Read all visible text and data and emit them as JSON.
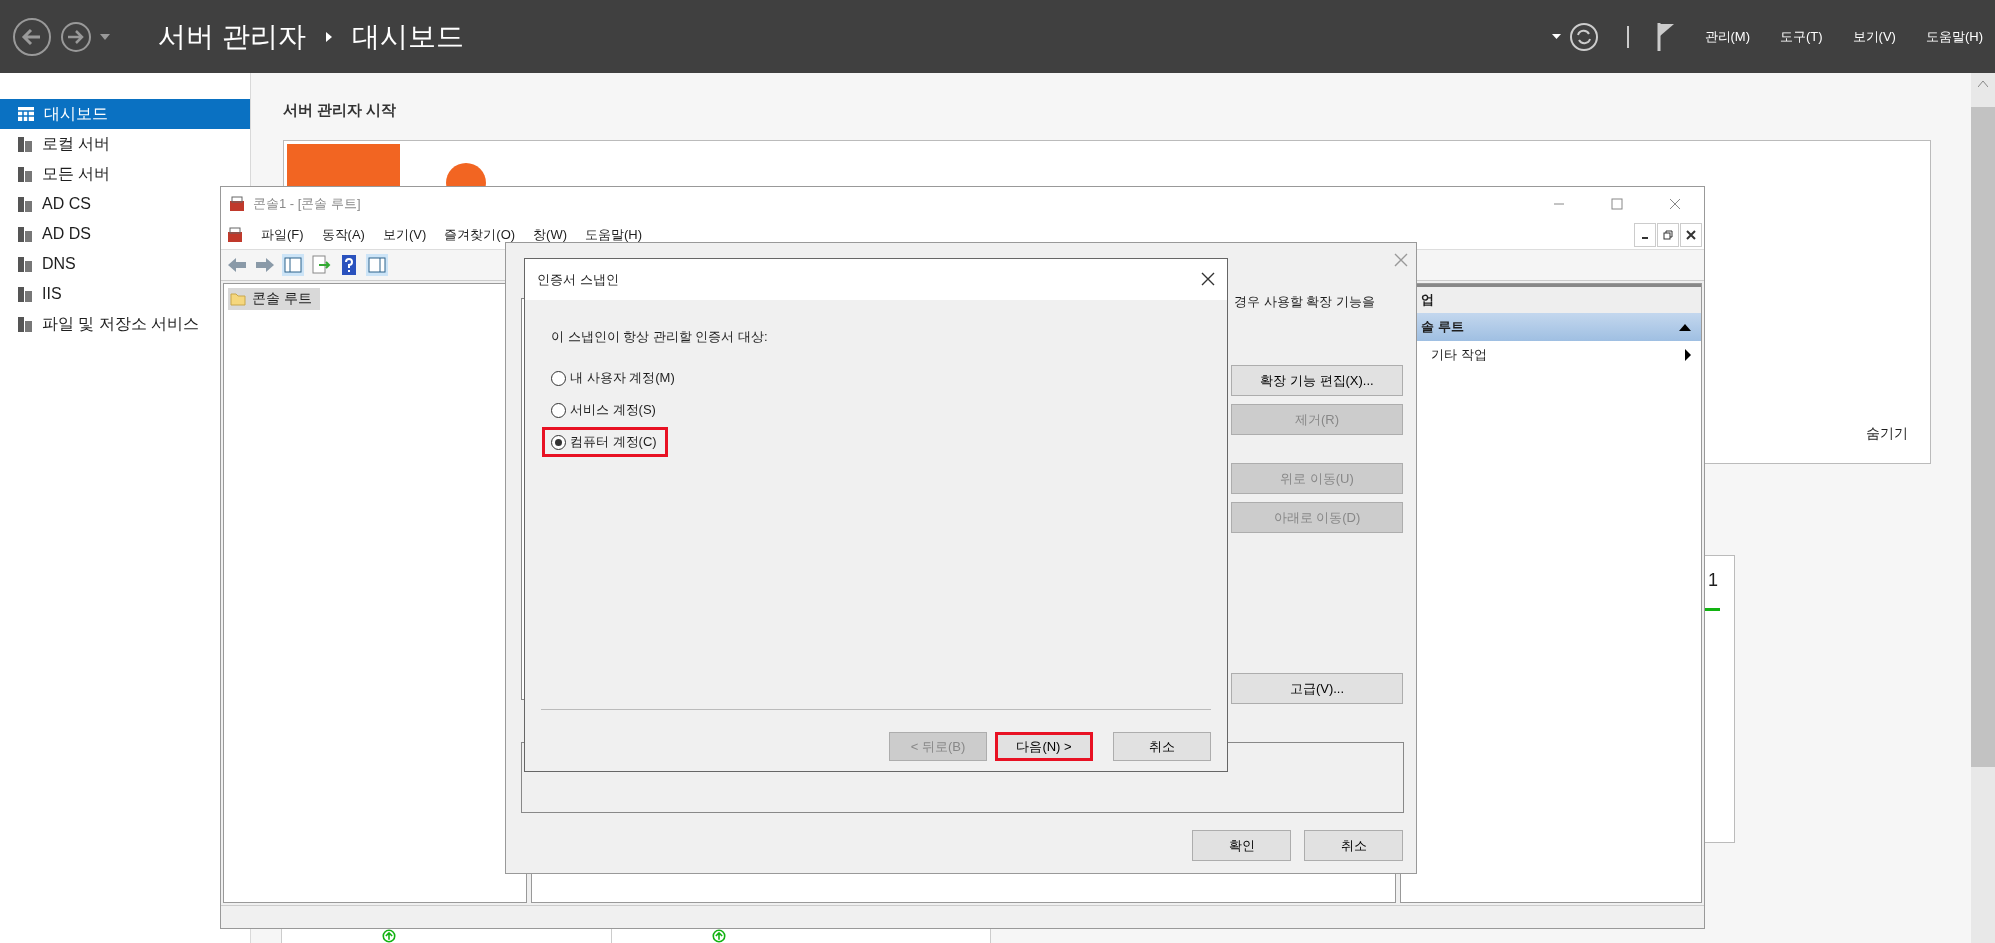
{
  "top_bar": {
    "breadcrumb": [
      "서버 관리자",
      "대시보드"
    ],
    "menu": [
      "관리(M)",
      "도구(T)",
      "보기(V)",
      "도움말(H)"
    ]
  },
  "sidebar": {
    "items": [
      {
        "label": "대시보드",
        "selected": true
      },
      {
        "label": "로컬 서버",
        "selected": false
      },
      {
        "label": "모든 서버",
        "selected": false
      },
      {
        "label": "AD CS",
        "selected": false
      },
      {
        "label": "AD DS",
        "selected": false
      },
      {
        "label": "DNS",
        "selected": false
      },
      {
        "label": "IIS",
        "selected": false
      },
      {
        "label": "파일 및 저장소 서비스",
        "selected": false
      }
    ]
  },
  "dashboard": {
    "heading": "서버 관리자 시작",
    "hide_link": "숨기기",
    "tile_count": "1",
    "tiles": [
      {
        "kind": "status"
      },
      {
        "kind": "status"
      }
    ]
  },
  "console": {
    "title": "콘솔1 - [콘솔 루트]",
    "menu": [
      "파일(F)",
      "동작(A)",
      "보기(V)",
      "즐겨찾기(O)",
      "창(W)",
      "도움말(H)"
    ],
    "tree": [
      {
        "label": "콘솔 루트",
        "selected": true
      }
    ],
    "actions": {
      "header": "업",
      "items": [
        {
          "label": "솔 루트",
          "selected": true,
          "kind": "group"
        },
        {
          "label": "기타 작업",
          "selected": false,
          "kind": "submenu"
        }
      ]
    }
  },
  "snapin_dialog": {
    "description": "경우 사용할 확장 기능을",
    "buttons": [
      {
        "label": "확장 기능 편집(X)...",
        "disabled": false
      },
      {
        "label": "제거(R)",
        "disabled": true
      },
      {
        "label": "위로 이동(U)",
        "disabled": true
      },
      {
        "label": "아래로 이동(D)",
        "disabled": true
      },
      {
        "label": "고급(V)...",
        "disabled": false
      }
    ],
    "footer_buttons": [
      "확인",
      "취소"
    ]
  },
  "cert_dialog": {
    "title": "인증서 스냅인",
    "prompt": "이 스냅인이 항상 관리할 인증서 대상:",
    "options": [
      {
        "label": "내 사용자 계정(M)",
        "selected": false,
        "highlighted": false
      },
      {
        "label": "서비스 계정(S)",
        "selected": false,
        "highlighted": false
      },
      {
        "label": "컴퓨터 계정(C)",
        "selected": true,
        "highlighted": true
      }
    ],
    "buttons": [
      {
        "label": "< 뒤로(B)",
        "disabled": true,
        "highlighted": false
      },
      {
        "label": "다음(N) >",
        "disabled": false,
        "highlighted": true
      },
      {
        "label": "취소",
        "disabled": false,
        "highlighted": false
      }
    ]
  }
}
